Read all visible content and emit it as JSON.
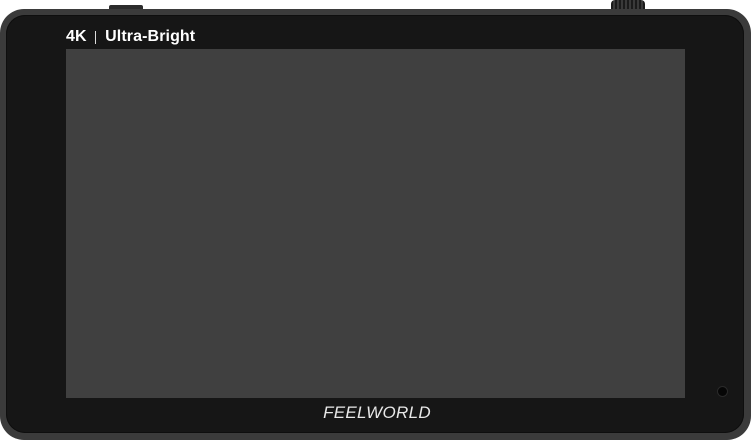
{
  "device": {
    "header": {
      "resolution": "4K",
      "tagline": "Ultra-Bright"
    },
    "brand": "FEELWORLD",
    "colors": {
      "chassis": "#3b3b3b",
      "bezel": "#161616",
      "screen": "#404040",
      "text": "#ffffff"
    }
  }
}
